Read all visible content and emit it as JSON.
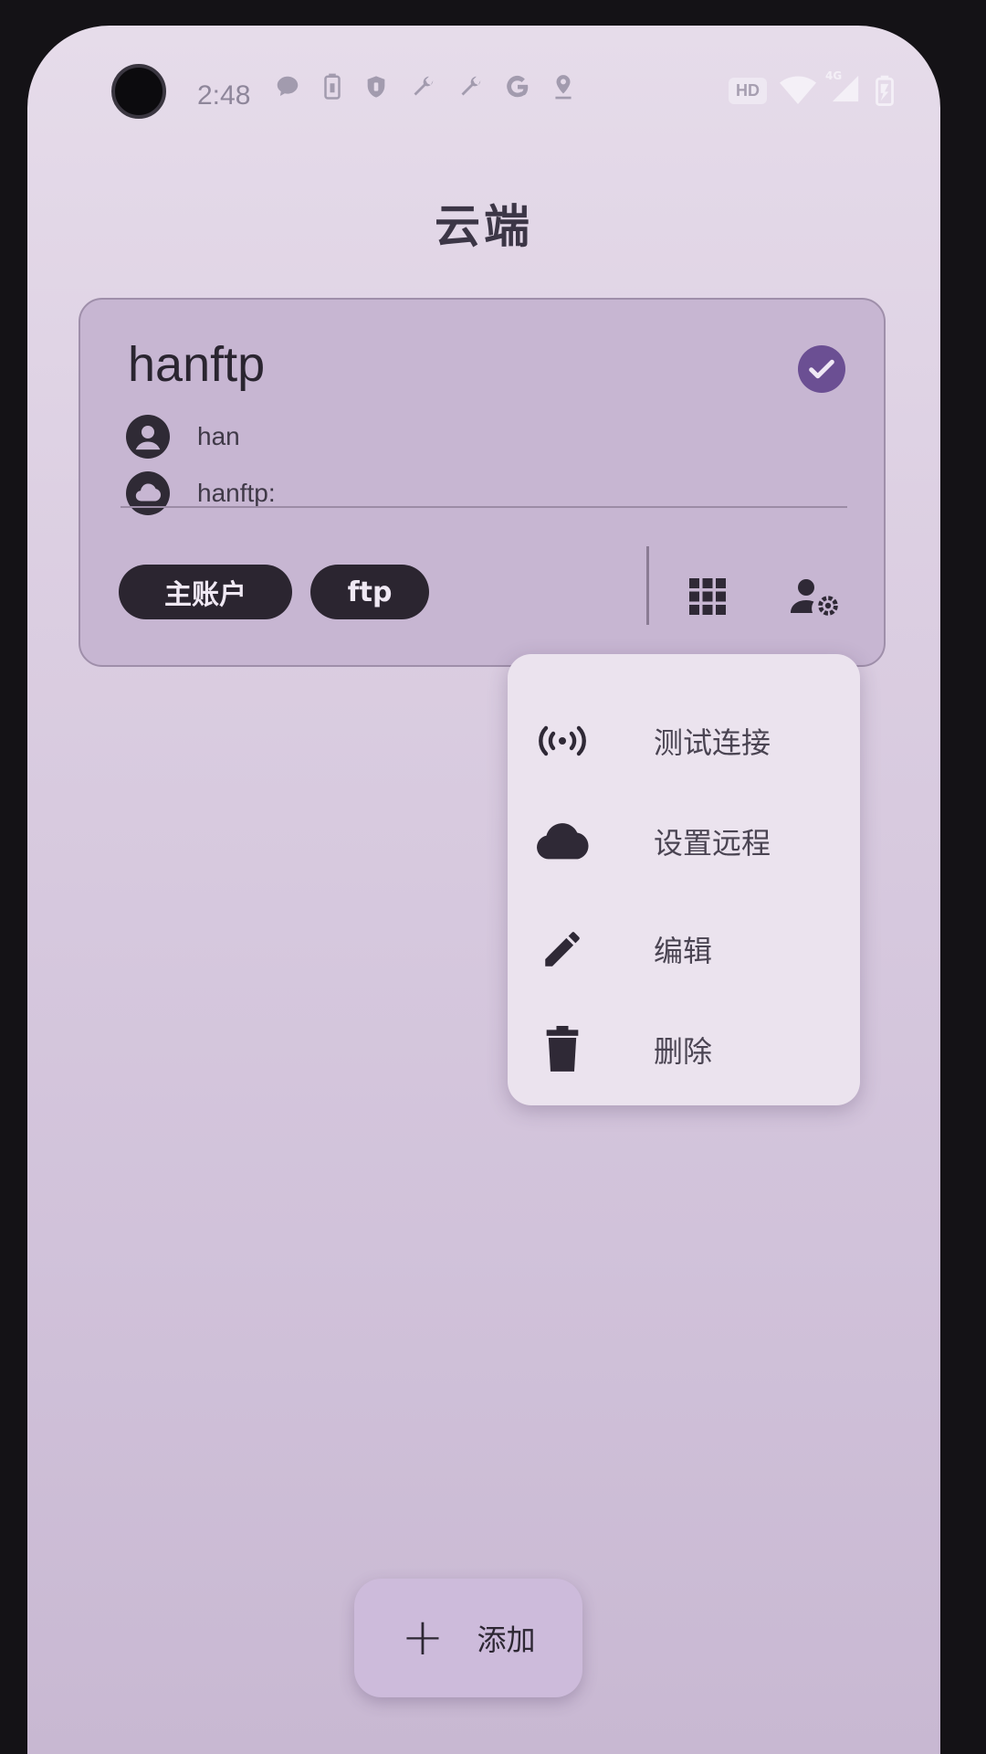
{
  "status_bar": {
    "time": "2:48",
    "left_icons": [
      "chat-icon",
      "battery-saver-icon",
      "shield-icon",
      "wrench-icon",
      "wrench-icon",
      "google-icon",
      "location-icon"
    ],
    "hd_badge": "HD",
    "network": "4G"
  },
  "header": {
    "title": "云端"
  },
  "account_card": {
    "name": "hanftp",
    "selected": true,
    "user": "han",
    "remote": "hanftp:",
    "chips": [
      "主账户",
      "ftp"
    ]
  },
  "menu": {
    "items": [
      {
        "icon": "broadcast-icon",
        "label": "测试连接"
      },
      {
        "icon": "cloud-icon",
        "label": "设置远程"
      },
      {
        "icon": "pencil-icon",
        "label": "编辑"
      },
      {
        "icon": "trash-icon",
        "label": "删除"
      }
    ]
  },
  "fab": {
    "plus": "+",
    "label": "添加"
  }
}
